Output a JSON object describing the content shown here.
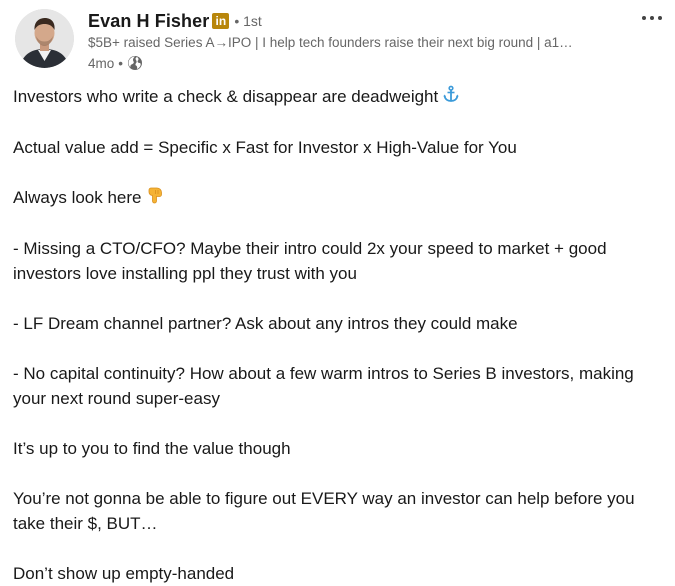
{
  "author": {
    "name": "Evan H Fisher",
    "badge": "in",
    "degree": "1st",
    "headline": "$5B+ raised Series A→IPO | I help tech founders raise their next big round | a1…",
    "time": "4mo",
    "visibility_icon": "globe-icon"
  },
  "menu": {
    "icon": "more-horizontal-icon"
  },
  "post": {
    "paragraphs": [
      "Investors who write a check & disappear are deadweight",
      "Actual value add = Specific x Fast for Investor x High-Value for You",
      "Always look here",
      "- Missing a CTO/CFO? Maybe their intro could 2x your speed to market + good investors love installing ppl they trust with you",
      "- LF Dream channel partner? Ask about any intros they could make",
      "- No capital continuity? How about a few warm intros to Series B investors, making your next round super-easy",
      "It’s up to you to find the value though",
      "You’re not gonna be able to figure out EVERY way an investor can help before you take their $, BUT…",
      "Don’t show up empty-handed"
    ],
    "emojis": {
      "p0": "anchor-emoji",
      "p2": "pointing-down-emoji"
    }
  },
  "colors": {
    "text": "#191919",
    "muted": "#666666",
    "badge": "#b8860b",
    "anchor": "#3b9ad9",
    "hand": "#f5b335"
  }
}
